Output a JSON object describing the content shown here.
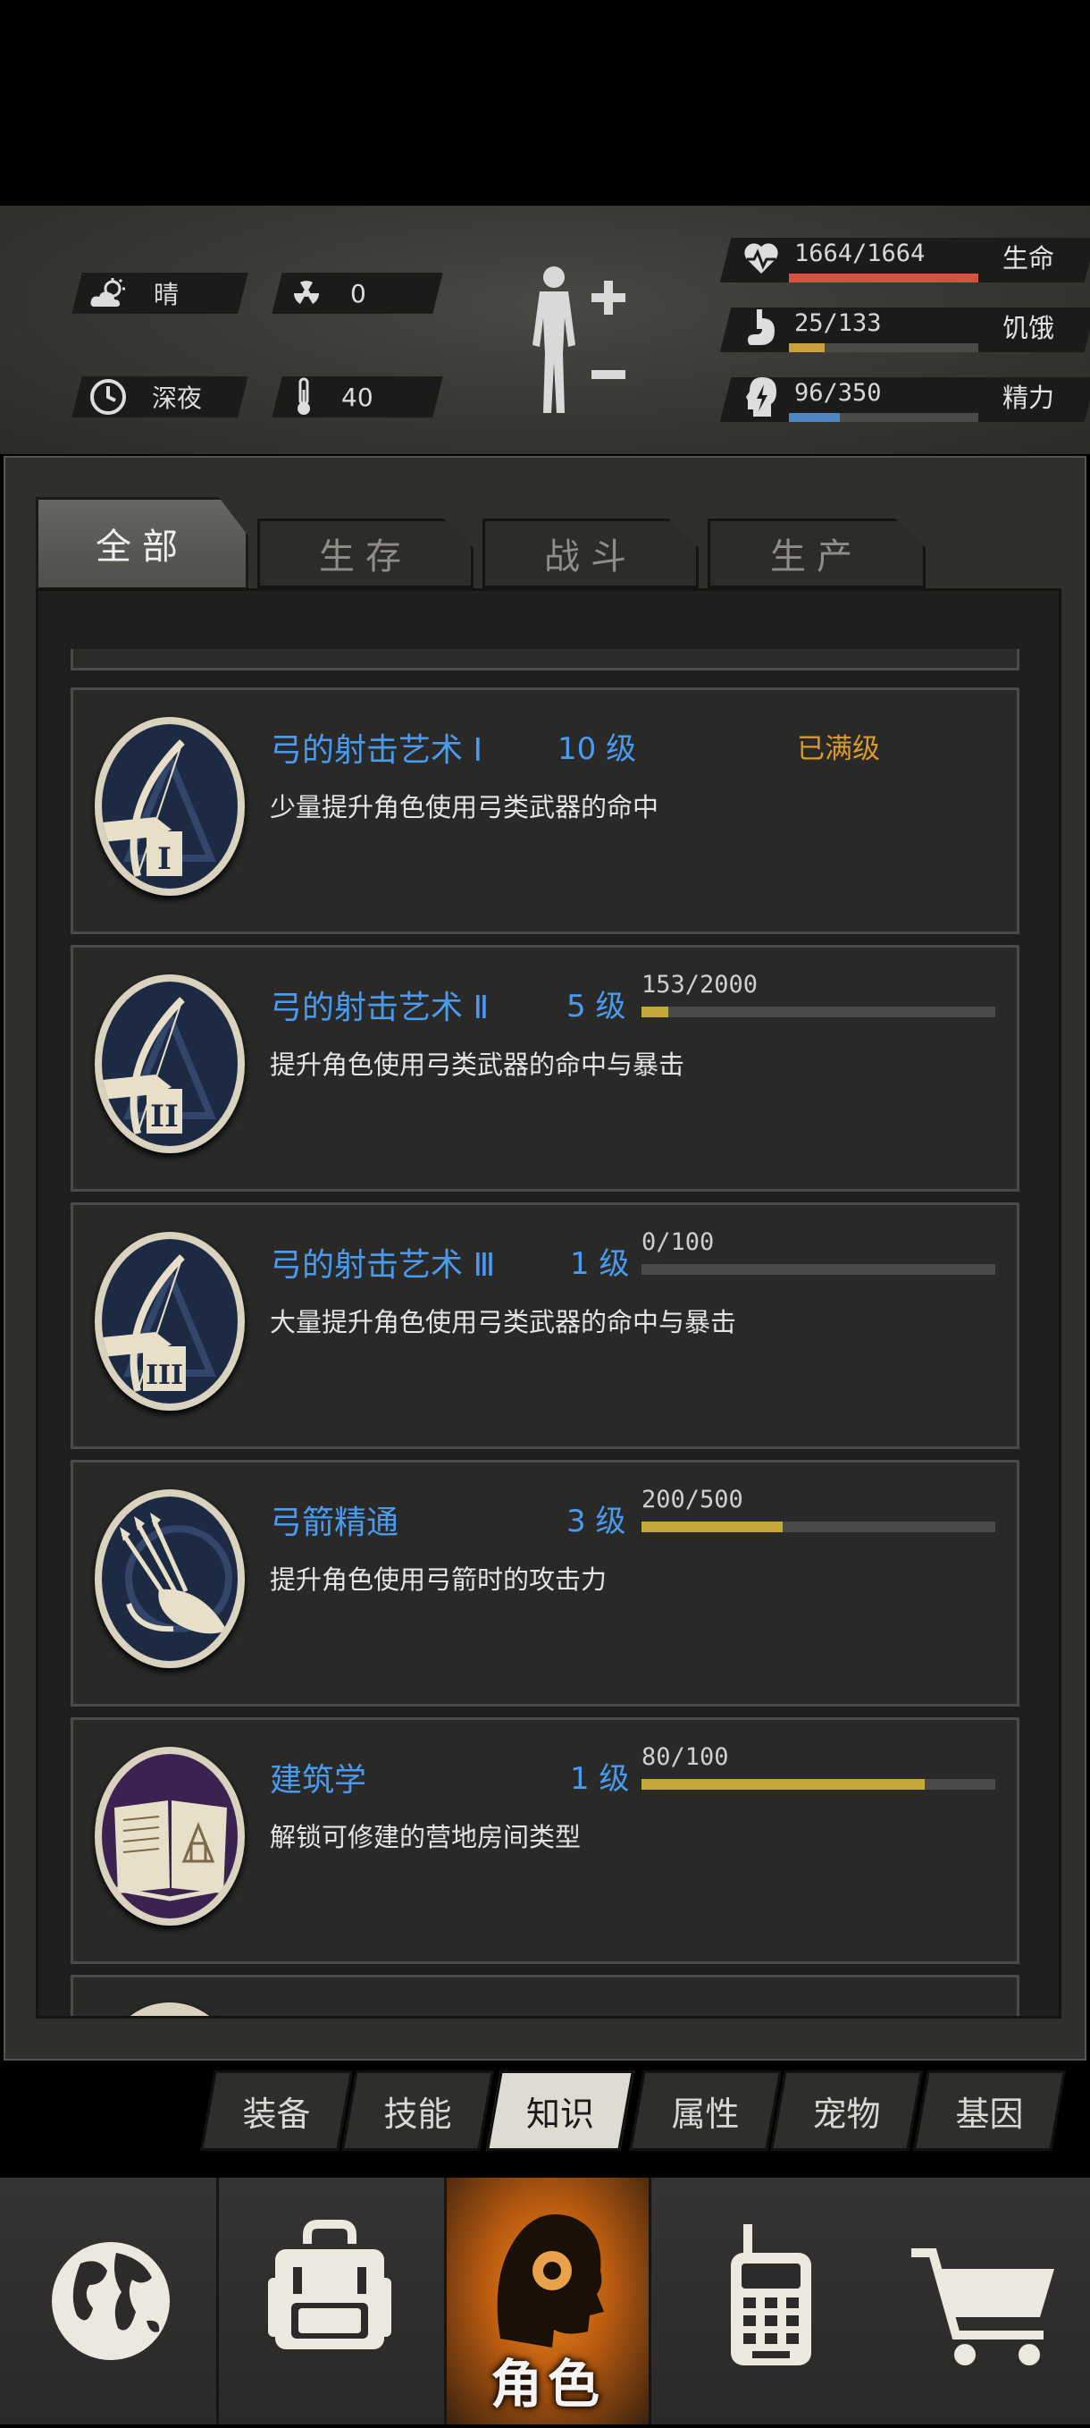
{
  "status": {
    "weather": {
      "icon": "sun-cloud-icon",
      "label": "晴"
    },
    "radiation": {
      "icon": "radiation-icon",
      "value": "0"
    },
    "time": {
      "icon": "clock-icon",
      "label": "深夜"
    },
    "temperature": {
      "icon": "thermometer-icon",
      "value": "40"
    },
    "vitals": [
      {
        "icon": "heart-pulse-icon",
        "value": "1664/1664",
        "label": "生命",
        "fraction": 1.0,
        "color": "#d9503f"
      },
      {
        "icon": "stomach-icon",
        "value": "25/133",
        "label": "饥饿",
        "fraction": 0.19,
        "color": "#c9a23e"
      },
      {
        "icon": "brain-bolt-icon",
        "value": "96/350",
        "label": "精力",
        "fraction": 0.27,
        "color": "#4d86c4"
      }
    ]
  },
  "tabs": [
    {
      "label": "全部",
      "active": true
    },
    {
      "label": "生存",
      "active": false
    },
    {
      "label": "战斗",
      "active": false
    },
    {
      "label": "生产",
      "active": false
    }
  ],
  "skills": [
    {
      "name": "弓的射击艺术 Ⅰ",
      "level": "10 级",
      "desc": "少量提升角色使用弓类武器的命中",
      "maxed_label": "已满级",
      "icon": "bow-icon",
      "numeral": "I"
    },
    {
      "name": "弓的射击艺术 Ⅱ",
      "level": "5 级",
      "desc": "提升角色使用弓类武器的命中与暴击",
      "progress": "153/2000",
      "fraction": 0.0765,
      "icon": "bow-icon",
      "numeral": "II"
    },
    {
      "name": "弓的射击艺术 Ⅲ",
      "level": "1 级",
      "desc": "大量提升角色使用弓类武器的命中与暴击",
      "progress": "0/100",
      "fraction": 0.0,
      "icon": "bow-icon",
      "numeral": "III"
    },
    {
      "name": "弓箭精通",
      "level": "3 级",
      "desc": "提升角色使用弓箭时的攻击力",
      "progress": "200/500",
      "fraction": 0.4,
      "icon": "quiver-icon"
    },
    {
      "name": "建筑学",
      "level": "1 级",
      "desc": "解锁可修建的营地房间类型",
      "progress": "80/100",
      "fraction": 0.8,
      "icon": "blueprint-book-icon"
    }
  ],
  "subtabs": [
    {
      "label": "装备",
      "active": false
    },
    {
      "label": "技能",
      "active": false
    },
    {
      "label": "知识",
      "active": true
    },
    {
      "label": "属性",
      "active": false
    },
    {
      "label": "宠物",
      "active": false
    },
    {
      "label": "基因",
      "active": false
    }
  ],
  "bottom_nav": {
    "world": {
      "icon": "globe-icon"
    },
    "backpack": {
      "icon": "backpack-icon"
    },
    "role": {
      "icon": "head-gear-icon",
      "label": "角色",
      "active": true
    },
    "radio": {
      "icon": "walkie-talkie-icon"
    },
    "shop": {
      "icon": "cart-icon"
    }
  }
}
